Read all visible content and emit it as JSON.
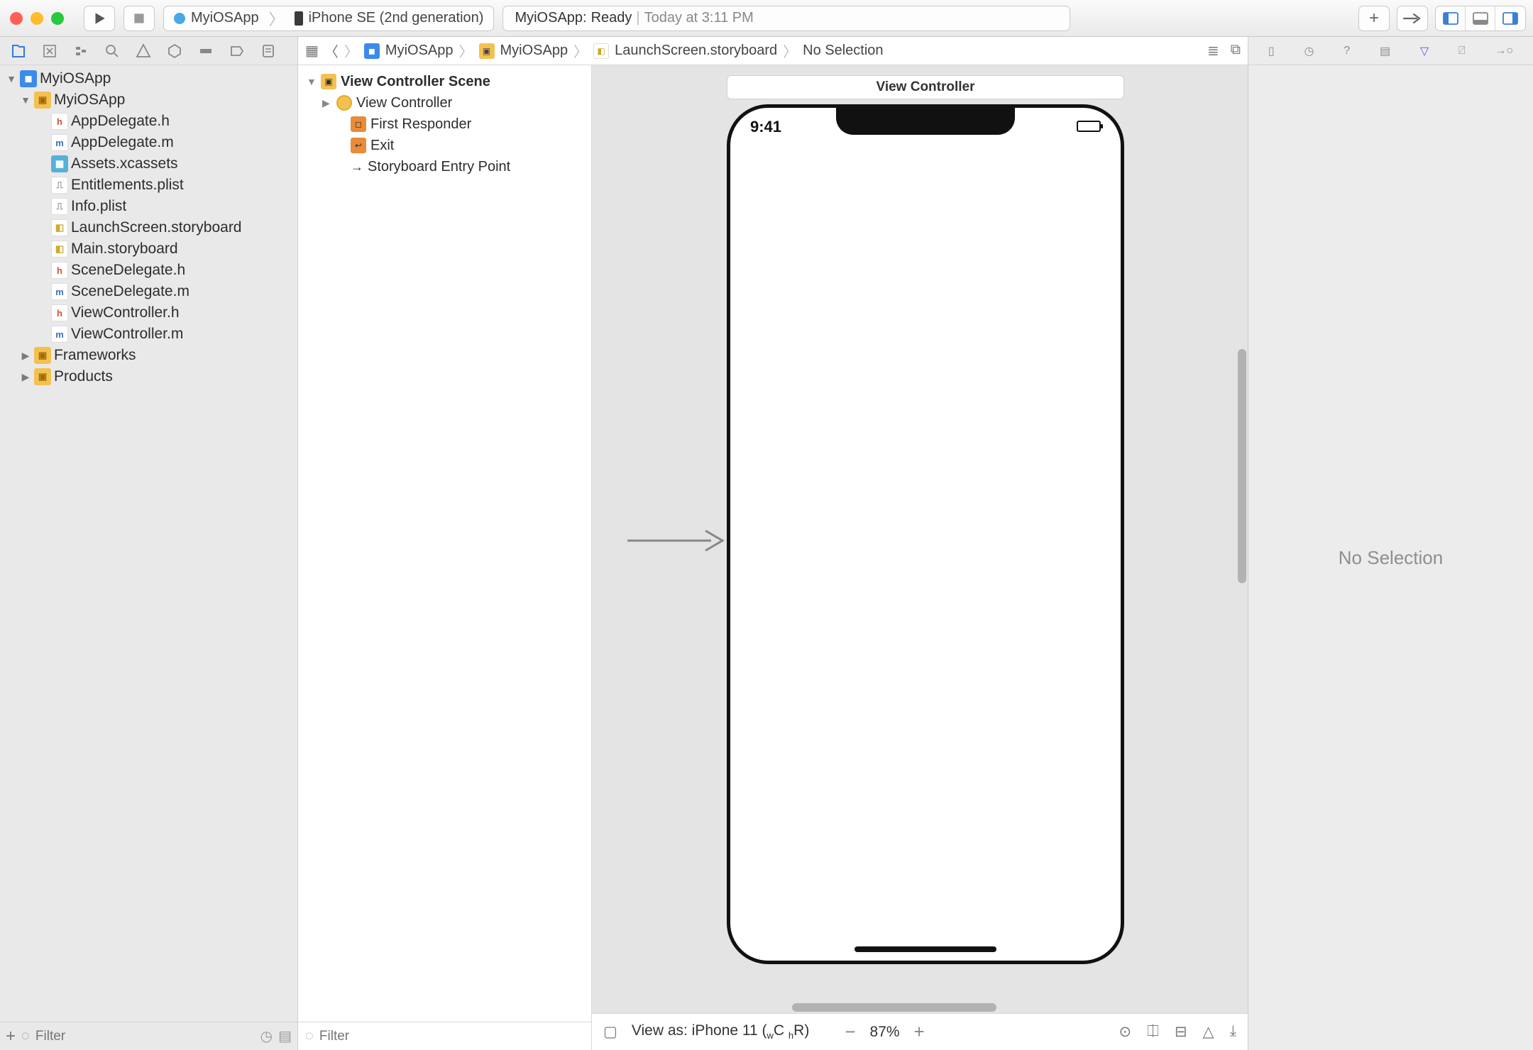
{
  "toolbar": {
    "scheme": {
      "target": "MyiOSApp",
      "device": "iPhone SE (2nd generation)"
    },
    "build_status": {
      "project": "MyiOSApp:",
      "state": "Ready",
      "sep": "|",
      "when": "Today at 3:11 PM"
    }
  },
  "nav": {
    "filter_placeholder": "Filter",
    "tree": {
      "root": "MyiOSApp",
      "group": "MyiOSApp",
      "files": [
        {
          "label": "AppDelegate.h",
          "ic": "h"
        },
        {
          "label": "AppDelegate.m",
          "ic": "m"
        },
        {
          "label": "Assets.xcassets",
          "ic": "assets"
        },
        {
          "label": "Entitlements.plist",
          "ic": "plist"
        },
        {
          "label": "Info.plist",
          "ic": "plist"
        },
        {
          "label": "LaunchScreen.storyboard",
          "ic": "sb"
        },
        {
          "label": "Main.storyboard",
          "ic": "sb"
        },
        {
          "label": "SceneDelegate.h",
          "ic": "h"
        },
        {
          "label": "SceneDelegate.m",
          "ic": "m"
        },
        {
          "label": "ViewController.h",
          "ic": "h"
        },
        {
          "label": "ViewController.m",
          "ic": "m"
        }
      ],
      "frameworks": "Frameworks",
      "products": "Products"
    }
  },
  "breadcrumb": {
    "items": [
      "MyiOSApp",
      "MyiOSApp",
      "LaunchScreen.storyboard",
      "No Selection"
    ]
  },
  "outline": {
    "scene": "View Controller Scene",
    "vc": "View Controller",
    "first_responder": "First Responder",
    "exit": "Exit",
    "entry": "Storyboard Entry Point",
    "filter_placeholder": "Filter"
  },
  "canvas": {
    "scene_title": "View Controller",
    "phone_time": "9:41",
    "view_as_label": "View as: iPhone 11 (",
    "view_as_wc": "C",
    "view_as_hr": "R)",
    "view_as_w": "w",
    "view_as_h": "h",
    "zoom": "87%"
  },
  "inspector": {
    "empty": "No Selection"
  }
}
